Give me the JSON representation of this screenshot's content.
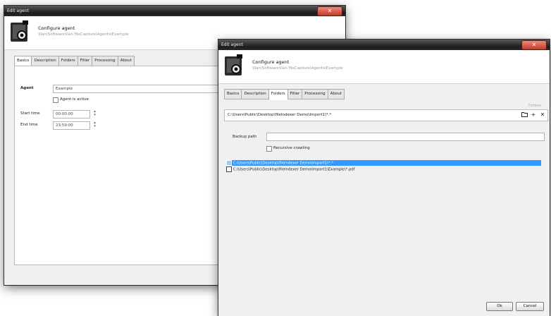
{
  "back_window": {
    "title": "Edit agent",
    "header_title": "Configure agent",
    "header_path": "\\Ilan\\Software\\Ilan fileCapture\\Agents\\Example",
    "tabs": [
      "Basics",
      "Description",
      "Folders",
      "Filter",
      "Processing",
      "About"
    ],
    "active_tab": "Basics",
    "agent_label": "Agent",
    "agent_value": "Example",
    "active_checkbox_label": "Agent is active",
    "start_time_label": "Start time",
    "start_time_value": "00:00:00",
    "end_time_label": "End time",
    "end_time_value": "23:59:00"
  },
  "front_window": {
    "title": "Edit agent",
    "header_title": "Configure agent",
    "header_path": "\\Ilan\\Software\\Ilan fileCapture\\Agents\\Example",
    "tabs": [
      "Basics",
      "Description",
      "Folders",
      "Filter",
      "Processing",
      "About"
    ],
    "active_tab": "Folders",
    "section_hint": "Folders",
    "folder_path": "C:\\Users\\Public\\Desktop\\fileIndexer Demo\\Import1\\*.*",
    "backup_label": "Backup path",
    "backup_value": "",
    "recursive_label": "Recursive crawling",
    "folders": [
      "C:\\Users\\Public\\Desktop\\fileIndexer Demo\\Import1\\*.*",
      "C:\\Users\\Public\\Desktop\\fileIndexer Demo\\Import1\\Example\\*.pdf"
    ],
    "selected_index": 0,
    "ok_label": "Ok",
    "cancel_label": "Cancel"
  },
  "icons": {
    "close": "close-x",
    "agent": "agent-camera-icon",
    "open_folder": "folder-open-icon",
    "add": "plus-icon",
    "remove": "x-icon"
  }
}
